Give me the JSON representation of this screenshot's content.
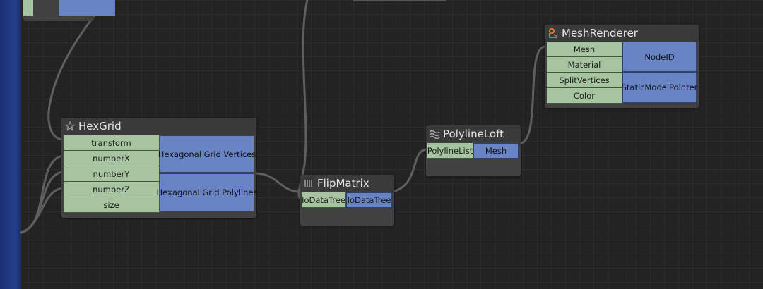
{
  "nodes": {
    "hexgrid": {
      "title": "HexGrid",
      "icon": "star-gear-icon",
      "inputs": [
        "transform",
        "numberX",
        "numberY",
        "numberZ",
        "size"
      ],
      "outputs": [
        "Hexagonal Grid Vertices",
        "Hexagonal Grid Polylines"
      ]
    },
    "flipmatrix": {
      "title": "FlipMatrix",
      "icon": "matrix-icon",
      "inputs": [
        "IoDataTree"
      ],
      "outputs": [
        "IoDataTree"
      ]
    },
    "polylineloft": {
      "title": "PolylineLoft",
      "icon": "loft-icon",
      "inputs": [
        "PolylineList"
      ],
      "outputs": [
        "Mesh"
      ]
    },
    "meshrenderer": {
      "title": "MeshRenderer",
      "icon": "renderer-icon",
      "inputs": [
        "Mesh",
        "Material",
        "SplitVertices",
        "Color"
      ],
      "outputs": [
        "NodeID",
        "StaticModelPointer"
      ]
    }
  },
  "colors": {
    "background": "#232323",
    "node_body": "#414141",
    "input_port": "#a6c4a0",
    "output_port": "#6984c4",
    "wire": "#5f5f5f",
    "sidebar": "#243f8e"
  }
}
